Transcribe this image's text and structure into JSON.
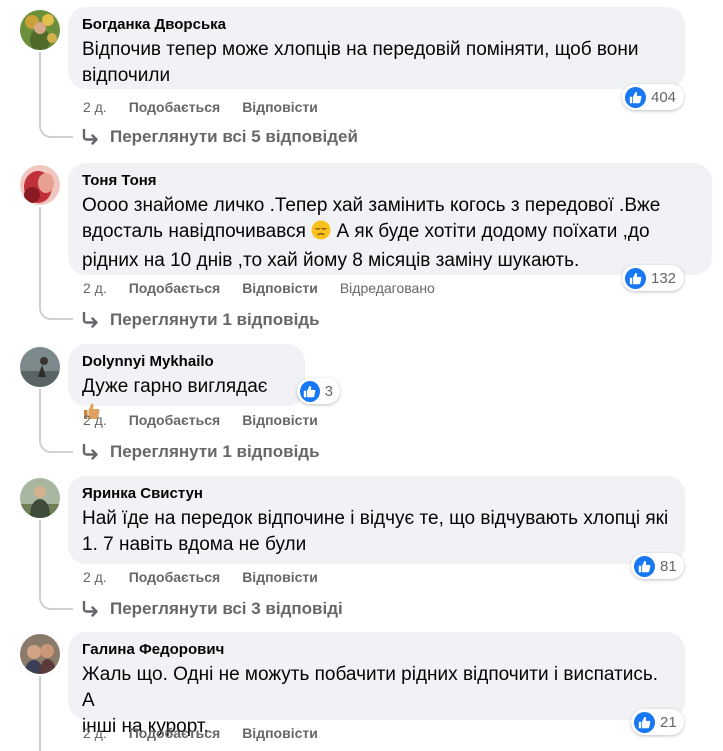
{
  "comments": [
    {
      "author": "Богданка Дворська",
      "text_lines": [
        "Відпочив тепер може хлопців на передовій поміняти, щоб вони",
        "відпочили"
      ],
      "time": "2 д.",
      "like_label": "Подобається",
      "reply_label": "Відповісти",
      "edited": "",
      "reaction_count": "404",
      "view_replies": "Переглянути всі 5 відповідей"
    },
    {
      "author": "Тоня Тоня",
      "text_lines": [
        "Оооо знайоме личко .Тепер хай замінить когось з передової .Вже",
        "вдосталь навідпочивався",
        " А як буде хотіти додому поїхати ,до",
        "рідних на 10 днів ,то хай йому 8 місяців заміну шукають."
      ],
      "time": "2 д.",
      "like_label": "Подобається",
      "reply_label": "Відповісти",
      "edited": "Відредаговано",
      "reaction_count": "132",
      "view_replies": "Переглянути 1 відповідь"
    },
    {
      "author": "Dolynnyi Mykhailo",
      "text_lines": [
        "Дуже гарно виглядає"
      ],
      "time": "2 д.",
      "like_label": "Подобається",
      "reply_label": "Відповісти",
      "edited": "",
      "reaction_count": "3",
      "view_replies": "Переглянути 1 відповідь"
    },
    {
      "author": "Яринка Свистун",
      "text_lines": [
        "Най їде на передок відпочине і відчує те, що відчувають хлопці які",
        "1. 7 навіть вдома не були"
      ],
      "time": "2 д.",
      "like_label": "Подобається",
      "reply_label": "Відповісти",
      "edited": "",
      "reaction_count": "81",
      "view_replies": "Переглянути всі 3 відповіді"
    },
    {
      "author": "Галина Федорович",
      "text_lines": [
        "Жаль що. Одні не можуть побачити рідних відпочити і виспатись. А",
        "інші на курорт."
      ],
      "time": "2 д.",
      "like_label": "Подобається",
      "reply_label": "Відповісти",
      "edited": "",
      "reaction_count": "21",
      "view_replies": ""
    }
  ],
  "icons": {
    "reaction": "like-thumb-icon",
    "reply": "reply-arrow-icon",
    "pensive_emoji": "pensive-face-emoji-icon",
    "thumbs_up_emoji": "thumbs-up-emoji-icon"
  },
  "colors": {
    "bubble": "#f0f2f5",
    "like_blue": "#1877f2",
    "secondary_text": "#65676b"
  }
}
